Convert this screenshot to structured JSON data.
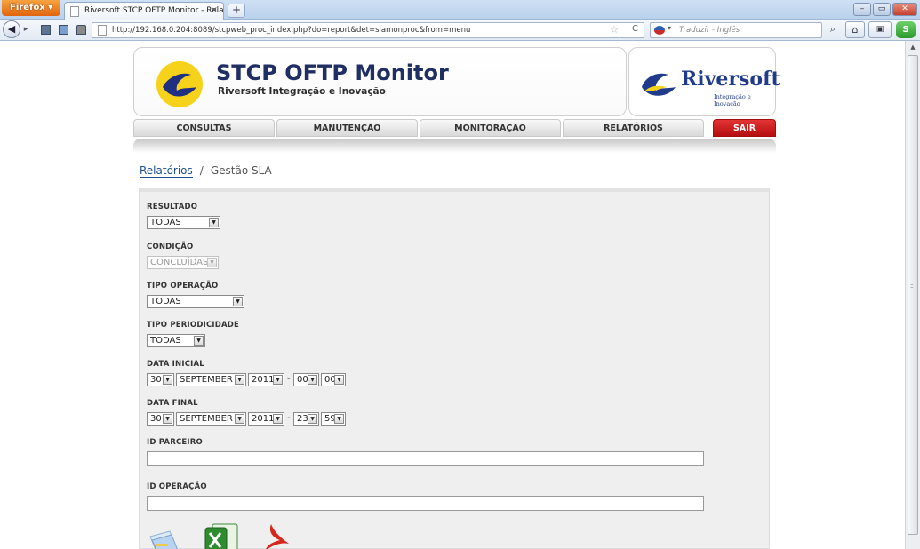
{
  "browser": {
    "menu_button": "Firefox",
    "tab_title": "Riversoft STCP OFTP Monitor - Relatório...",
    "tab_close": "×",
    "new_tab": "+",
    "url": "http://192.168.0.204:8089/stcpweb_proc_index.php?do=report&det=slamonproc&from=menu",
    "search_placeholder": "Traduzir - Inglês",
    "window_min": "–",
    "window_max": "▭",
    "window_close": "✕",
    "back": "◀",
    "forward": "▸",
    "star": "☆",
    "reload": "C",
    "search_go": "⌕",
    "home": "⌂",
    "download": "▣",
    "skype": "S"
  },
  "header": {
    "title": "STCP OFTP Monitor",
    "subtitle": "Riversoft Integração e Inovação",
    "brand_name": "Riversoft",
    "brand_tagline": "Integração e Inovação"
  },
  "menu": {
    "consultas": "CONSULTAS",
    "manutencao": "MANUTENÇÃO",
    "monitoracao": "MONITORAÇÃO",
    "relatorios": "RELATÓRIOS",
    "sair": "SAIR"
  },
  "breadcrumb": {
    "link": "Relatórios",
    "separator": "/",
    "current": "Gestão SLA"
  },
  "form": {
    "resultado": {
      "label": "RESULTADO",
      "value": "TODAS"
    },
    "condicao": {
      "label": "CONDIÇÃO",
      "value": "CONCLUÍDAS",
      "disabled": true
    },
    "tipo_operacao": {
      "label": "TIPO OPERAÇÃO",
      "value": "TODAS"
    },
    "tipo_periodicidade": {
      "label": "TIPO PERIODICIDADE",
      "value": "TODAS"
    },
    "data_inicial": {
      "label": "DATA INICIAL",
      "day": "30",
      "month": "SEPTEMBER",
      "year": "2011",
      "hour": "00",
      "minute": "00"
    },
    "data_final": {
      "label": "DATA FINAL",
      "day": "30",
      "month": "SEPTEMBER",
      "year": "2011",
      "hour": "23",
      "minute": "59"
    },
    "time_dash": "-",
    "dropdown_arrow": "▼",
    "id_parceiro": {
      "label": "ID PARCEIRO",
      "value": ""
    },
    "id_operacao": {
      "label": "ID OPERAÇÃO",
      "value": ""
    }
  },
  "icons": {
    "export_doc": "document-icon",
    "export_xls": "excel-icon",
    "export_pdf": "pdf-icon"
  },
  "colors": {
    "title": "#1f2f63",
    "brand": "#1f3b8a",
    "exit_button": "#c41a1a",
    "link": "#1d4e8f",
    "panel": "#efefef"
  }
}
